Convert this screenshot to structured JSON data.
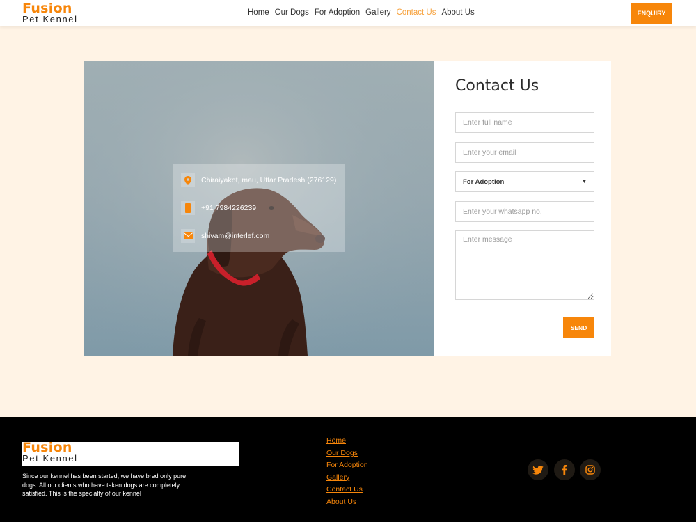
{
  "brand": {
    "name_line1": "Fusion",
    "name_line2": "Pet Kennel",
    "accent_color": "#f7860a"
  },
  "nav": {
    "items": [
      {
        "label": "Home",
        "active": false
      },
      {
        "label": "Our Dogs",
        "active": false
      },
      {
        "label": "For Adoption",
        "active": false
      },
      {
        "label": "Gallery",
        "active": false
      },
      {
        "label": "Contact Us",
        "active": true
      },
      {
        "label": "About Us",
        "active": false
      }
    ],
    "enquiry_label": "ENQUIRY"
  },
  "contact_info": {
    "address": "Chiraiyakot, mau, Uttar Pradesh (276129)",
    "phone": "+91 7984226239",
    "email": "shivam@interlef.com",
    "icons": [
      "location-pin-icon",
      "phone-icon",
      "mail-icon"
    ]
  },
  "form": {
    "title": "Contact Us",
    "name_placeholder": "Enter full name",
    "email_placeholder": "Enter your email",
    "inquiry_type_value": "For Adoption",
    "whatsapp_placeholder": "Enter your whatsapp no.",
    "message_placeholder": "Enter message",
    "send_label": "SEND"
  },
  "footer": {
    "description": "Since our kennel has been started, we have bred only pure dogs. All our clients who have taken dogs are completely satisfied. This is the specialty of our kennel",
    "links": [
      "Home",
      "Our Dogs",
      "For Adoption",
      "Gallery",
      "Contact Us",
      "About Us"
    ],
    "social_icons": [
      "twitter-icon",
      "facebook-icon",
      "instagram-icon"
    ]
  }
}
